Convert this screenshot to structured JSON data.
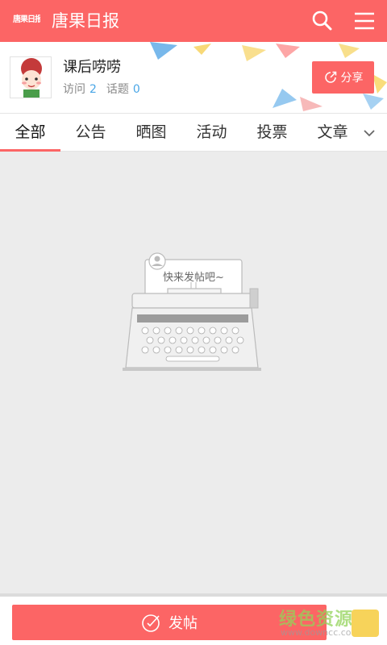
{
  "header": {
    "logo_text": "唐果日报",
    "app_title": "唐果日报",
    "search_icon": "search-icon",
    "menu_icon": "menu-icon"
  },
  "profile": {
    "group_name": "课后唠唠",
    "visits_label": "访问",
    "visits_count": "2",
    "topics_label": "话题",
    "topics_count": "0",
    "share_label": "分享"
  },
  "tabs": {
    "items": [
      {
        "label": "全部",
        "active": true
      },
      {
        "label": "公告",
        "active": false
      },
      {
        "label": "晒图",
        "active": false
      },
      {
        "label": "活动",
        "active": false
      },
      {
        "label": "投票",
        "active": false
      },
      {
        "label": "文章",
        "active": false
      }
    ]
  },
  "empty_state": {
    "message": "快来发帖吧~"
  },
  "bottom": {
    "post_label": "发帖"
  },
  "watermark": {
    "text": "绿色资源网",
    "url": "www.downcc.com"
  },
  "colors": {
    "brand": "#fc6565",
    "count": "#4aa6e6",
    "background": "#ececec"
  }
}
